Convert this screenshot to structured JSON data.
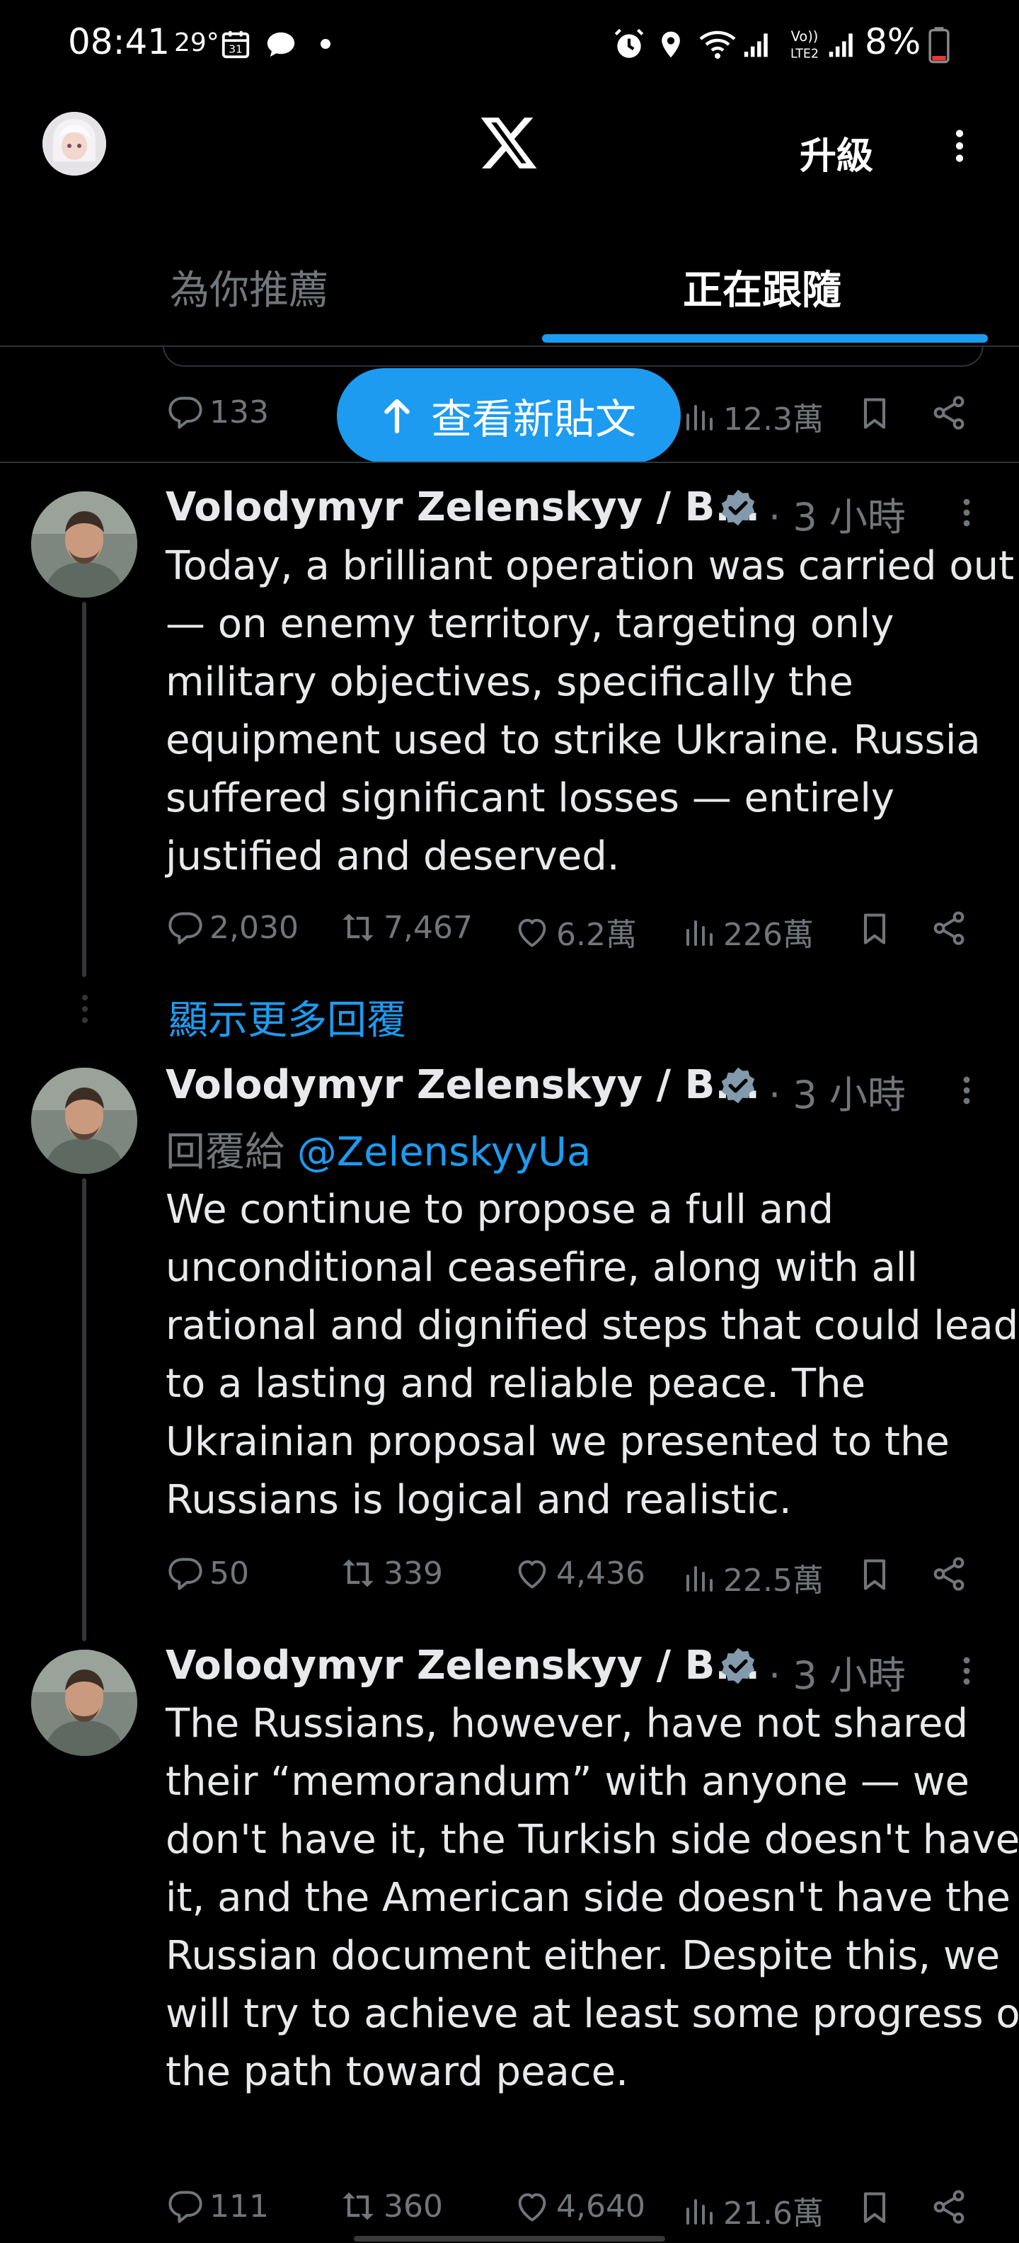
{
  "status": {
    "time": "08:41",
    "temperature": "29°",
    "battery": "8%",
    "icons": [
      "calendar-icon",
      "chat-bubble-icon",
      "dot-icon",
      "alarm-icon",
      "location-icon",
      "wifi-icon",
      "signal-icon",
      "volte-icon",
      "battery-icon"
    ]
  },
  "header": {
    "logo": "X",
    "upgrade_label": "升級"
  },
  "tabs": [
    {
      "label": "為你推薦",
      "active": false
    },
    {
      "label": "正在跟隨",
      "active": true
    }
  ],
  "new_posts_label": "查看新貼文",
  "prev_post": {
    "replies": "133",
    "views": "12.3萬"
  },
  "show_more_label": "顯示更多回覆",
  "posts": [
    {
      "author": "Volodymyr Zelenskyy / B...",
      "time": "3 小時",
      "body": "Today, a brilliant operation was carried out — on enemy territory, targeting only military objectives, specifically the equipment used to strike Ukraine. Russia suffered significant losses — entirely justified and deserved.",
      "replies": "2,030",
      "reposts": "7,467",
      "likes": "6.2萬",
      "views": "226萬"
    },
    {
      "author": "Volodymyr Zelenskyy / B...",
      "time": "3 小時",
      "reply_prefix": "回覆給",
      "reply_handle": "@ZelenskyyUa",
      "body": "We continue to propose a full and unconditional ceasefire, along with all rational and dignified steps that could lead to a lasting and reliable peace. The Ukrainian proposal we presented to the Russians is logical and realistic.",
      "replies": "50",
      "reposts": "339",
      "likes": "4,436",
      "views": "22.5萬"
    },
    {
      "author": "Volodymyr Zelenskyy / B...",
      "time": "3 小時",
      "body": "The Russians, however, have not shared their “memorandum” with anyone — we don't have it, the Turkish side doesn't have it, and the American side doesn't have the Russian document either. Despite this, we will try to achieve at least some progress on the path toward peace.",
      "replies": "111",
      "reposts": "360",
      "likes": "4,640",
      "views": "21.6萬"
    }
  ],
  "colors": {
    "accent": "#1d9bf0",
    "background": "#000000",
    "text": "#e7e9ea",
    "muted": "#71767b",
    "divider": "#2f3336"
  }
}
